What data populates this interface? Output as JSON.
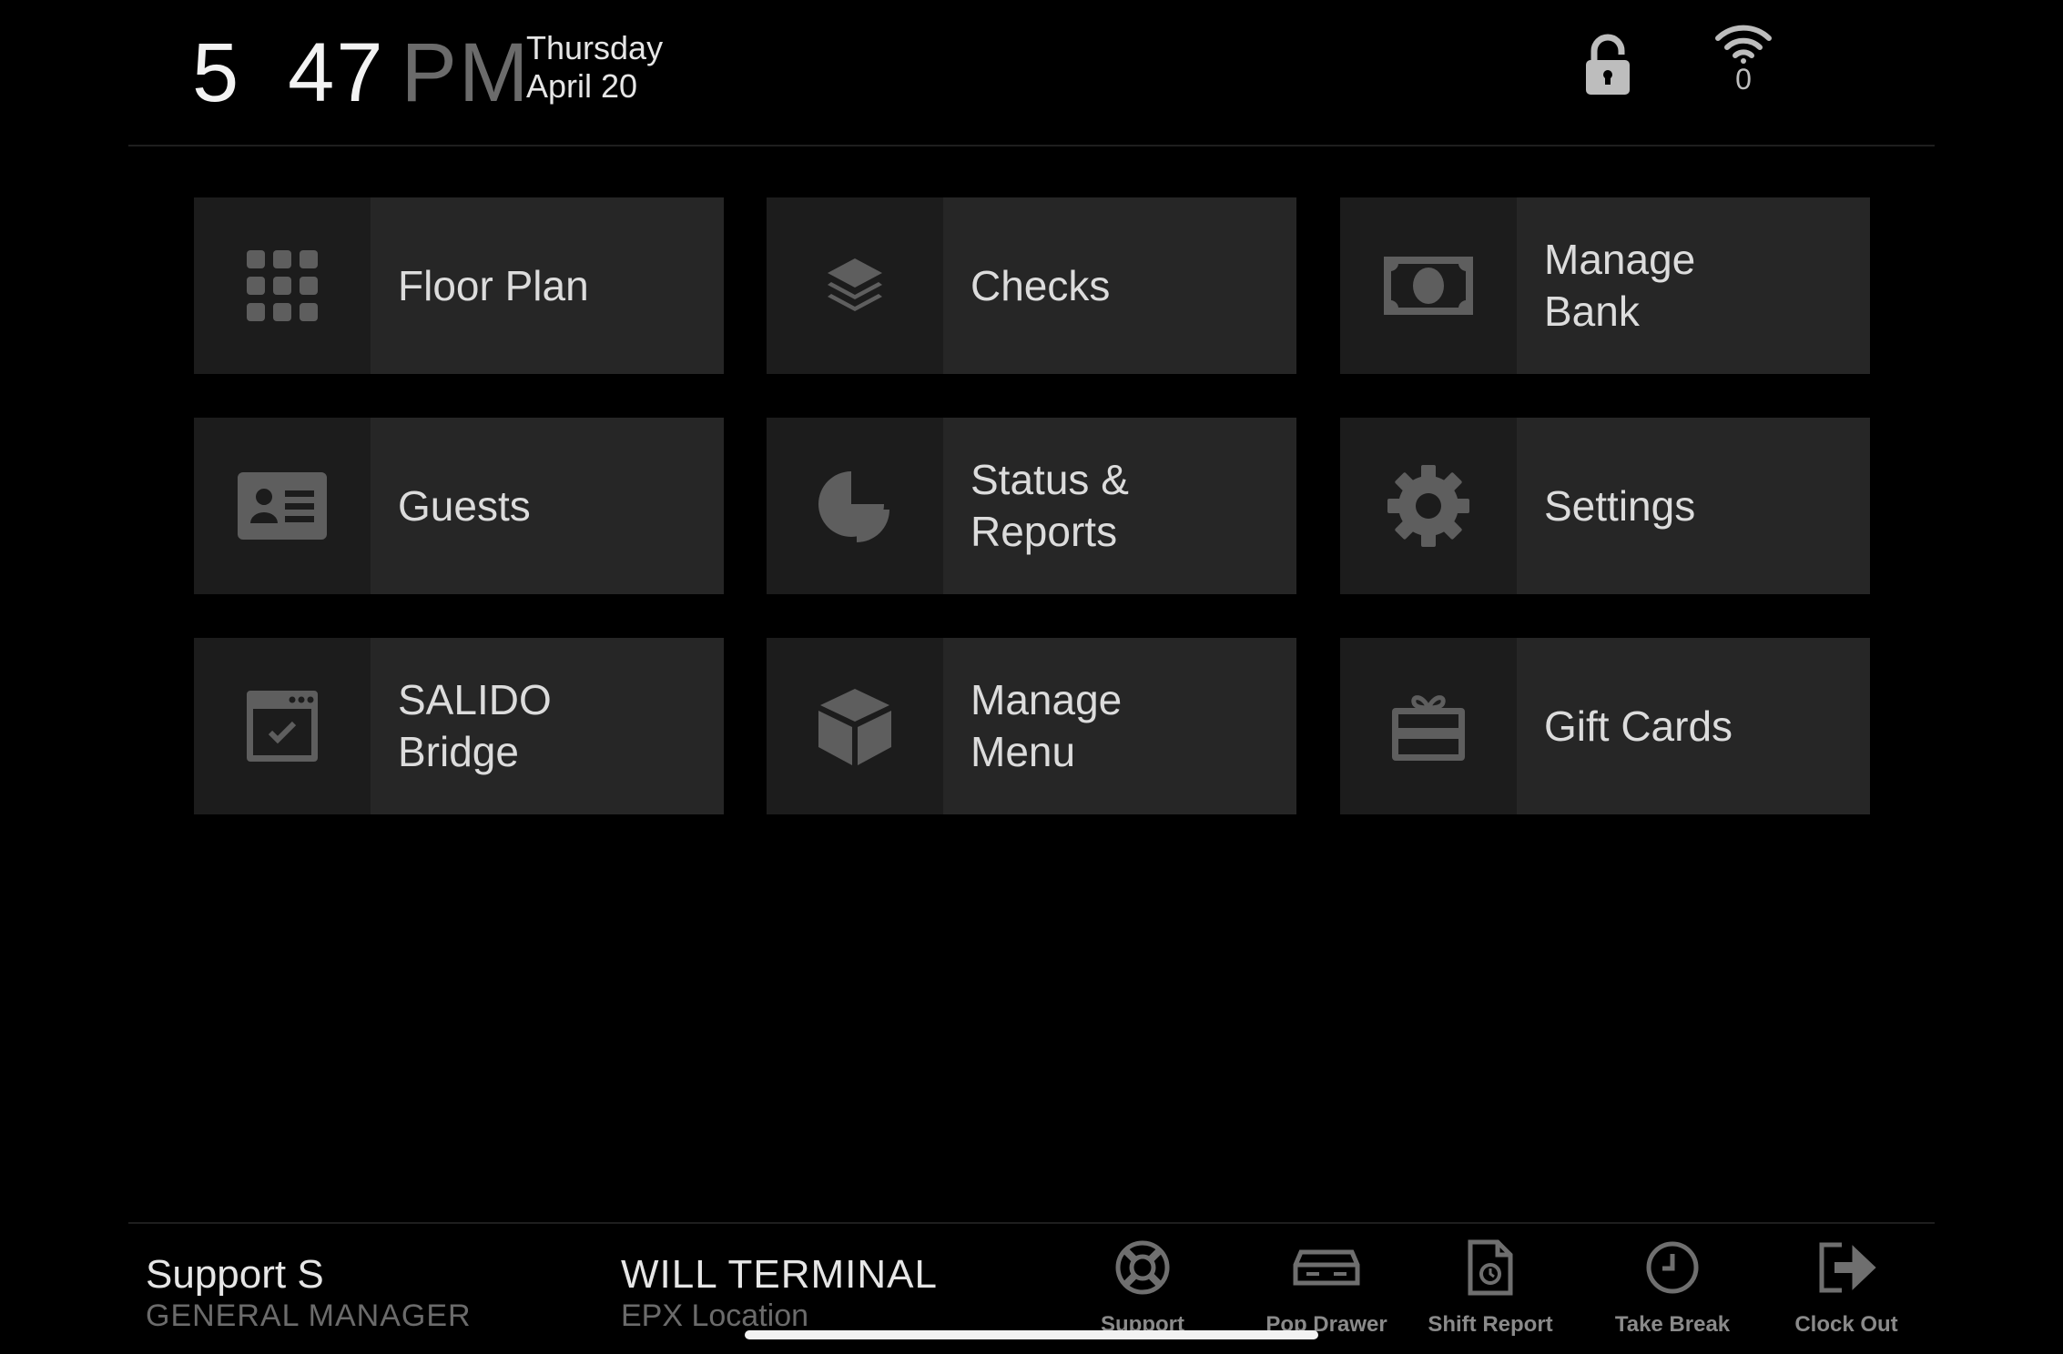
{
  "status": {
    "hour": "5",
    "minute": "47",
    "ampm": "PM",
    "weekday": "Thursday",
    "date": "April 20",
    "wifi_count": "0"
  },
  "tiles": [
    {
      "label": "Floor Plan",
      "icon": "grid-icon"
    },
    {
      "label": "Checks",
      "icon": "layers-icon"
    },
    {
      "label": "Manage\nBank",
      "icon": "money-icon"
    },
    {
      "label": "Guests",
      "icon": "id-card-icon"
    },
    {
      "label": "Status &\nReports",
      "icon": "pie-chart-icon"
    },
    {
      "label": "Settings",
      "icon": "gear-icon"
    },
    {
      "label": "SALIDO\nBridge",
      "icon": "calendar-check-icon"
    },
    {
      "label": "Manage\nMenu",
      "icon": "cube-icon"
    },
    {
      "label": "Gift Cards",
      "icon": "gift-card-icon"
    }
  ],
  "footer": {
    "user_name": "Support S",
    "user_role": "GENERAL MANAGER",
    "terminal_name": "WILL TERMINAL",
    "terminal_location": "EPX Location",
    "actions": [
      {
        "label": "Support",
        "icon": "lifebuoy-icon"
      },
      {
        "label": "Pop Drawer",
        "icon": "cash-drawer-icon"
      },
      {
        "label": "Shift Report",
        "icon": "report-icon"
      },
      {
        "label": "Take Break",
        "icon": "clock-icon"
      },
      {
        "label": "Clock Out",
        "icon": "sign-out-icon"
      }
    ]
  }
}
